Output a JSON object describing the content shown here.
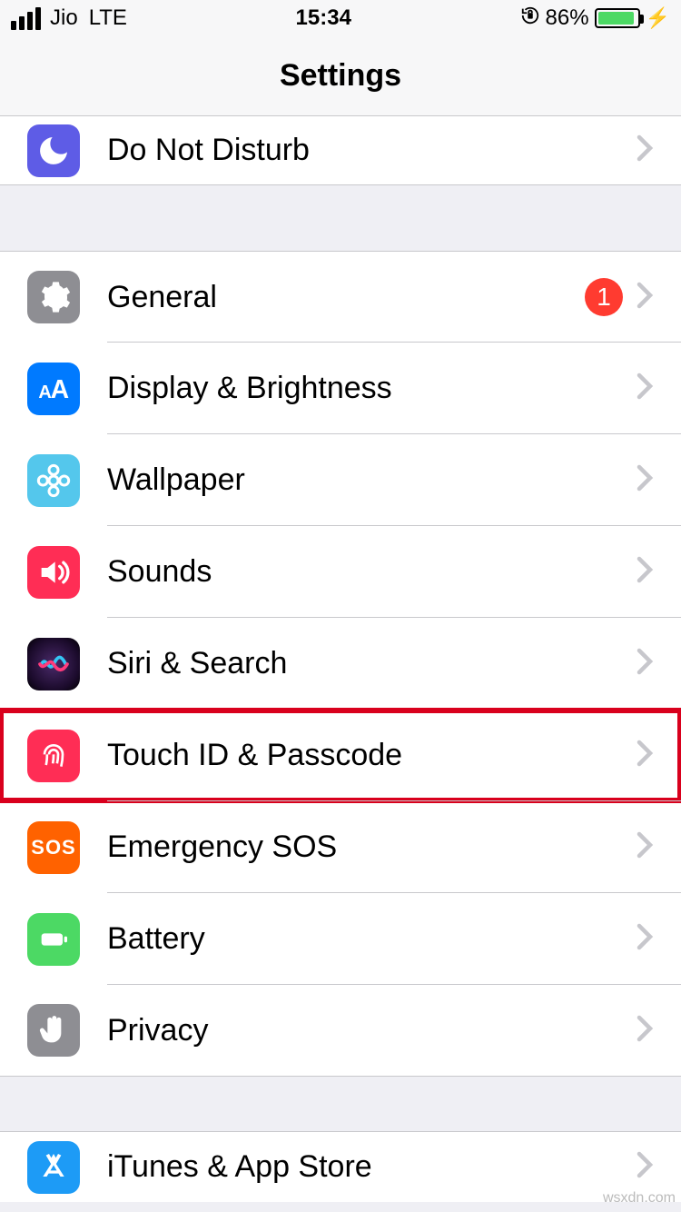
{
  "status": {
    "carrier": "Jio",
    "network": "LTE",
    "time": "15:34",
    "battery_pct": "86%",
    "battery_fill": 86
  },
  "nav": {
    "title": "Settings"
  },
  "rows": {
    "dnd": "Do Not Disturb",
    "general": "General",
    "general_badge": "1",
    "display": "Display & Brightness",
    "wallpaper": "Wallpaper",
    "sounds": "Sounds",
    "siri": "Siri & Search",
    "touchid": "Touch ID & Passcode",
    "sos": "Emergency SOS",
    "battery": "Battery",
    "privacy": "Privacy",
    "itunes": "iTunes & App Store"
  },
  "watermark": "wsxdn.com"
}
